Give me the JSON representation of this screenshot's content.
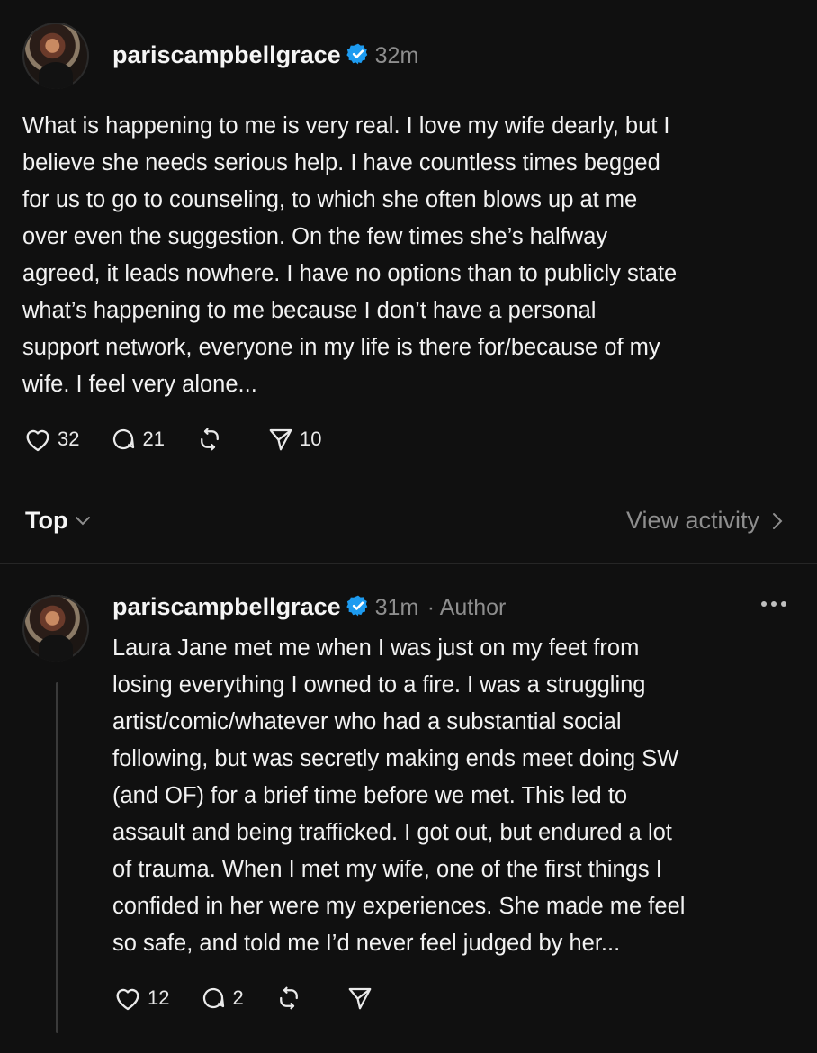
{
  "post": {
    "username": "pariscampbellgrace",
    "time": "32m",
    "lines": [
      "What is happening to me is very real. I love my wife dearly, but I",
      "believe she needs serious help. I have countless times begged",
      "for us to go to counseling, to which she often blows up at me",
      "over even the suggestion. On the few times she’s halfway",
      "agreed, it leads nowhere. I have no options than to publicly state",
      "what’s happening to me because I don’t have a personal",
      "support network, everyone in my life is there for/because of my",
      "wife. I feel very alone..."
    ],
    "likes": "32",
    "replies": "21",
    "shares": "10"
  },
  "filter": {
    "label": "Top",
    "view_activity": "View activity"
  },
  "reply": {
    "username": "pariscampbellgrace",
    "time": "31m",
    "role": "· Author",
    "lines": [
      "Laura Jane met me when I was just on my feet from",
      "losing everything I owned to a fire. I was a struggling",
      "artist/comic/whatever who had a substantial social",
      "following, but was secretly making ends meet doing SW",
      "(and OF) for a brief time before we met. This led to",
      "assault and being trafficked. I got out, but endured a lot",
      "of trauma. When I met my wife, one of the first things I",
      "confided in her were my experiences. She made me feel",
      "so safe, and told me I’d never feel judged by her..."
    ],
    "likes": "12",
    "replies": "2"
  },
  "colors": {
    "background": "#101010",
    "verified": "#1d9bf0",
    "muted": "#8e8e8e"
  }
}
